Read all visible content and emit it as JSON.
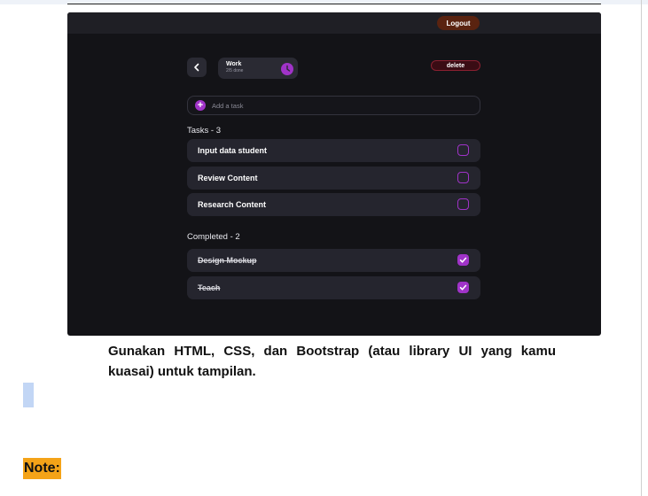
{
  "app": {
    "logout_label": "Logout",
    "list": {
      "name": "Work",
      "progress": "2/5 done"
    },
    "delete_label": "delete",
    "add_task_placeholder": "Add a task",
    "tasks_heading": "Tasks - 3",
    "tasks": [
      {
        "label": "Input data student",
        "done": false
      },
      {
        "label": "Review Content",
        "done": false
      },
      {
        "label": "Research Content",
        "done": false
      }
    ],
    "completed_heading": "Completed - 2",
    "completed": [
      {
        "label": "Design Mockup",
        "done": true
      },
      {
        "label": "Teach",
        "done": true
      }
    ]
  },
  "document": {
    "instruction": "Gunakan HTML, CSS, dan Bootstrap (atau library UI yang kamu kuasai) untuk tampilan.",
    "note_label": "Note:"
  },
  "icons": {
    "back": "chevron-left-icon",
    "clock": "clock-icon",
    "add": "plus-icon",
    "check": "check-icon"
  },
  "colors": {
    "accent": "#a033c8",
    "app_background": "#131317",
    "logout": "#5a2310",
    "delete": "#3a0c14",
    "note_highlight": "#f4a318"
  }
}
